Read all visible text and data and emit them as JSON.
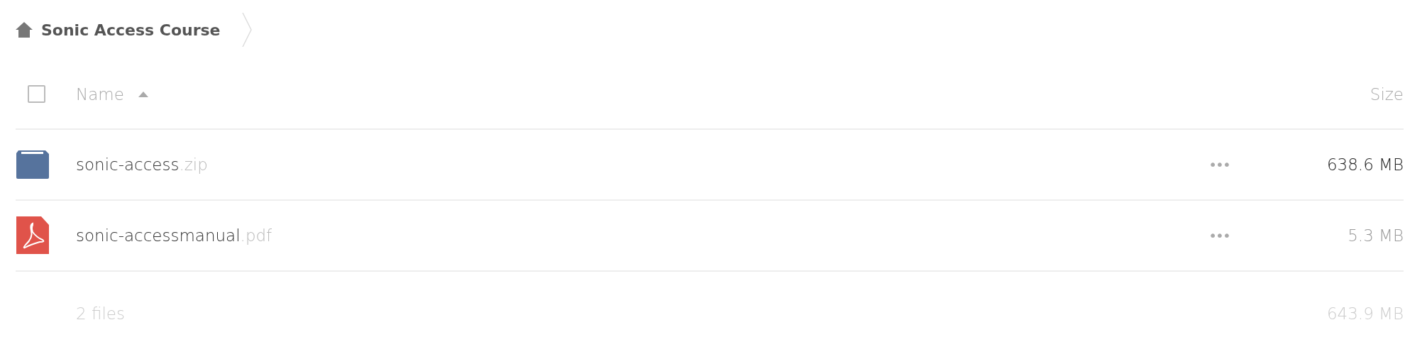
{
  "breadcrumb": {
    "title": "Sonic Access Course"
  },
  "table": {
    "select_all": {
      "checked": false
    },
    "columns": [
      {
        "label": "Name",
        "sort_ascending": true
      },
      {
        "label": "Size"
      }
    ],
    "rows": [
      {
        "kind": "archive",
        "name": "sonic-access",
        "extension": ".zip",
        "actions": "•••",
        "size": "638.6 MB",
        "hovered": true
      },
      {
        "kind": "pdf",
        "name": "sonic-accessmanual",
        "extension": ".pdf",
        "actions": "•••",
        "size": "5.3 MB",
        "hovered": false
      }
    ],
    "footer": {
      "count": "2 files",
      "total": "643.9 MB"
    }
  }
}
